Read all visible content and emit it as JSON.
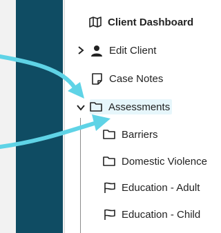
{
  "nav": {
    "client_dashboard": {
      "label": "Client Dashboard",
      "icon": "map-icon"
    },
    "edit_client": {
      "label": "Edit Client",
      "icon": "user-icon"
    },
    "case_notes": {
      "label": "Case Notes",
      "icon": "note-icon"
    },
    "assessments": {
      "label": "Assessments",
      "icon": "folder-icon"
    },
    "children": [
      {
        "label": "Barriers",
        "icon": "folder-icon"
      },
      {
        "label": "Domestic Violence",
        "icon": "folder-icon"
      },
      {
        "label": "Education - Adult",
        "icon": "flag-icon"
      },
      {
        "label": "Education - Child",
        "icon": "flag-icon"
      }
    ]
  },
  "colors": {
    "sidebar_stripe": "#0f4c63",
    "arrow": "#5fd3e6",
    "selected_bg": "#e6f6fb"
  }
}
